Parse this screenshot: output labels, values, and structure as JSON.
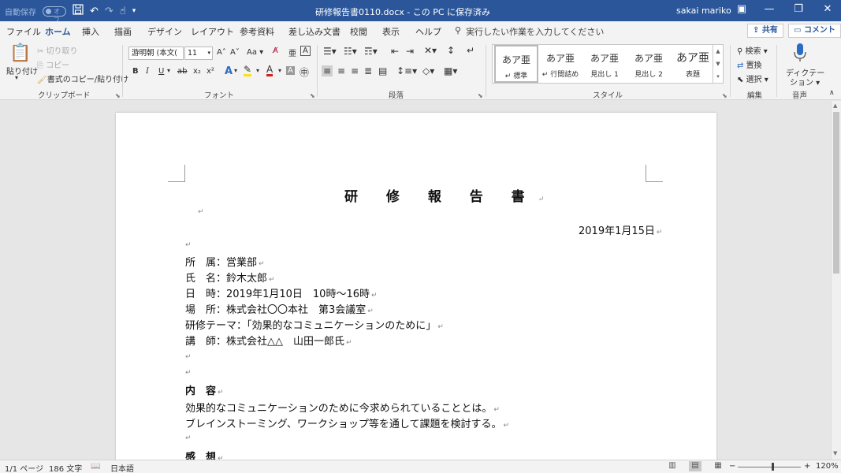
{
  "titlebar": {
    "autosave_label": "自動保存",
    "autosave_state": "オフ",
    "document_title": "研修報告書0110.docx - この PC に保存済み",
    "user_name": "sakai mariko",
    "icons": [
      "save-icon",
      "undo-icon",
      "redo-icon",
      "touch-mode-icon",
      "customize-qat-icon",
      "ribbon-display-icon",
      "minimize-icon",
      "restore-icon",
      "close-icon"
    ]
  },
  "tabs": {
    "items": [
      "ファイル",
      "ホーム",
      "挿入",
      "描画",
      "デザイン",
      "レイアウト",
      "参考資料",
      "差し込み文書",
      "校閲",
      "表示",
      "ヘルプ"
    ],
    "active": "ホーム",
    "tell_me": "実行したい作業を入力してください",
    "share": "共有",
    "comments": "コメント"
  },
  "ribbon": {
    "clipboard": {
      "paste": "貼り付け",
      "cut": "切り取り",
      "copy": "コピー",
      "format_painter": "書式のコピー/貼り付け",
      "label": "クリップボード"
    },
    "font": {
      "font_name": "游明朝 (本文(",
      "font_size": "11",
      "grow": "A˄",
      "shrink": "A˅",
      "change_case": "Aa",
      "bold": "B",
      "italic": "I",
      "underline": "U",
      "strike": "ab",
      "subscript": "x₂",
      "superscript": "x²",
      "label": "フォント"
    },
    "paragraph": {
      "label": "段落"
    },
    "styles": {
      "items": [
        {
          "sample": "あア亜",
          "name": "標準"
        },
        {
          "sample": "あア亜",
          "name": "行間詰め"
        },
        {
          "sample": "あア亜",
          "name": "見出し 1"
        },
        {
          "sample": "あア亜",
          "name": "見出し 2"
        },
        {
          "sample": "あア亜",
          "name": "表題"
        }
      ],
      "label": "スタイル"
    },
    "editing": {
      "find": "検索",
      "replace": "置換",
      "select": "選択",
      "label": "編集"
    },
    "voice": {
      "dictate_line1": "ディクテー",
      "dictate_line2": "ション",
      "label": "音声"
    }
  },
  "document": {
    "title": "研 修 報 告 書",
    "date": "2019年1月15日",
    "lines": [
      "所　属：営業部",
      "氏　名：鈴木太郎",
      "日　時：2019年1月10日　10時〜16時",
      "場　所：株式会社〇〇本社　第3会議室",
      "研修テーマ：「効果的なコミュニケーションのために」",
      "講　師：株式会社△△　山田一郎氏"
    ],
    "section_content": "内　容",
    "content_lines": [
      "効果的なコミュニケーションのために今求められていることとは。",
      "ブレインストーミング、ワークショップ等を通して課題を検討する。"
    ],
    "section_impressions": "感　想",
    "paragraph_mark": "↵"
  },
  "statusbar": {
    "page": "1/1 ページ",
    "words": "186 文字",
    "language": "日本語",
    "zoom": "120%",
    "zoom_minus": "−",
    "zoom_plus": "+"
  }
}
